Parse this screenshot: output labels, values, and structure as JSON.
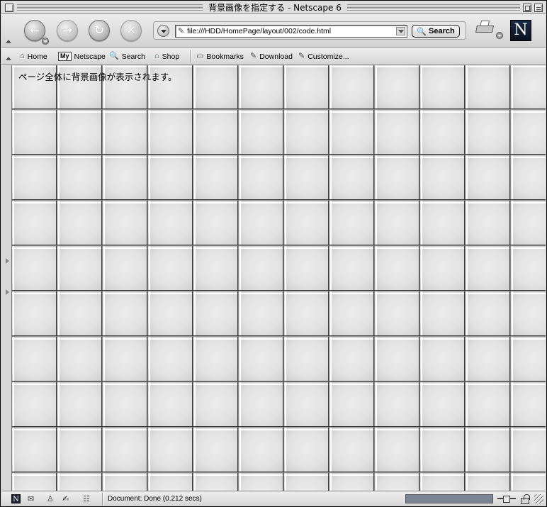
{
  "window": {
    "title": "背景画像を指定する - Netscape 6"
  },
  "navbar": {
    "back_icon": "back-arrow-icon",
    "forward_icon": "forward-arrow-icon",
    "reload_icon": "reload-icon",
    "stop_icon": "stop-icon",
    "url": "file:///HDD/HomePage/layout/002/code.html",
    "search_label": "Search"
  },
  "personal_toolbar": {
    "items": [
      {
        "label": "Home",
        "icon": "home-icon"
      },
      {
        "label": "Netscape",
        "badge": "My",
        "icon": "my-netscape-icon"
      },
      {
        "label": "Search",
        "icon": "search-icon"
      },
      {
        "label": "Shop",
        "icon": "shop-icon"
      },
      {
        "label": "Bookmarks",
        "icon": "bookmarks-folder-icon"
      },
      {
        "label": "Download",
        "icon": "download-icon"
      },
      {
        "label": "Customize...",
        "icon": "customize-icon"
      }
    ]
  },
  "content": {
    "text": "ページ全体に背景画像が表示されます。"
  },
  "statusbar": {
    "status": "Document: Done (0.212 secs)"
  },
  "colors": {
    "chrome": "#dcdcdc",
    "tile_light": "#e4e4e4",
    "tile_edge": "#3a3a3a",
    "progress_fill": "#7a8492",
    "logo_bg": "#0f1a2e"
  }
}
